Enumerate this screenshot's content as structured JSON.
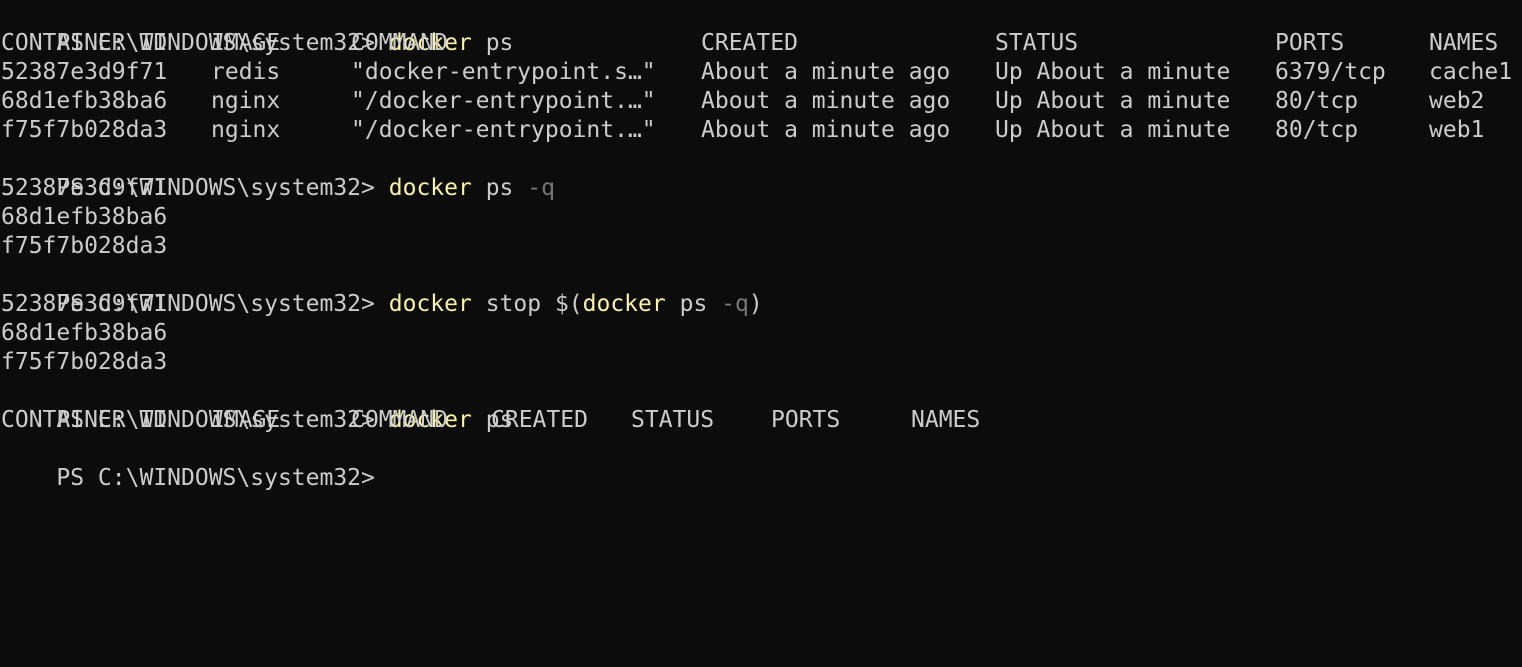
{
  "prompt": "PS C:\\WINDOWS\\system32>",
  "commands": {
    "c1": {
      "exe": "docker",
      "args": "ps"
    },
    "c2": {
      "exe": "docker",
      "args": "ps",
      "flag": "-q"
    },
    "c3": {
      "exe": "docker",
      "args": "stop $(",
      "inner_exe": "docker",
      "inner_args": "ps",
      "flag": "-q",
      "close": ")"
    },
    "c4": {
      "exe": "docker",
      "args": "ps"
    }
  },
  "ps_table": {
    "headers": [
      "CONTAINER ID",
      "IMAGE",
      "COMMAND",
      "CREATED",
      "STATUS",
      "PORTS",
      "NAMES"
    ],
    "rows": [
      [
        "52387e3d9f71",
        "redis",
        "\"docker-entrypoint.s…\"",
        "About a minute ago",
        "Up About a minute",
        "6379/tcp",
        "cache1"
      ],
      [
        "68d1efb38ba6",
        "nginx",
        "\"/docker-entrypoint.…\"",
        "About a minute ago",
        "Up About a minute",
        "80/tcp",
        "web2"
      ],
      [
        "f75f7b028da3",
        "nginx",
        "\"/docker-entrypoint.…\"",
        "About a minute ago",
        "Up About a minute",
        "80/tcp",
        "web1"
      ]
    ]
  },
  "ids_output": [
    "52387e3d9f71",
    "68d1efb38ba6",
    "f75f7b028da3"
  ],
  "stop_output": [
    "52387e3d9f71",
    "68d1efb38ba6",
    "f75f7b028da3"
  ],
  "empty_table_headers": [
    "CONTAINER ID",
    "IMAGE",
    "COMMAND",
    "CREATED",
    "STATUS",
    "PORTS",
    "NAMES"
  ]
}
